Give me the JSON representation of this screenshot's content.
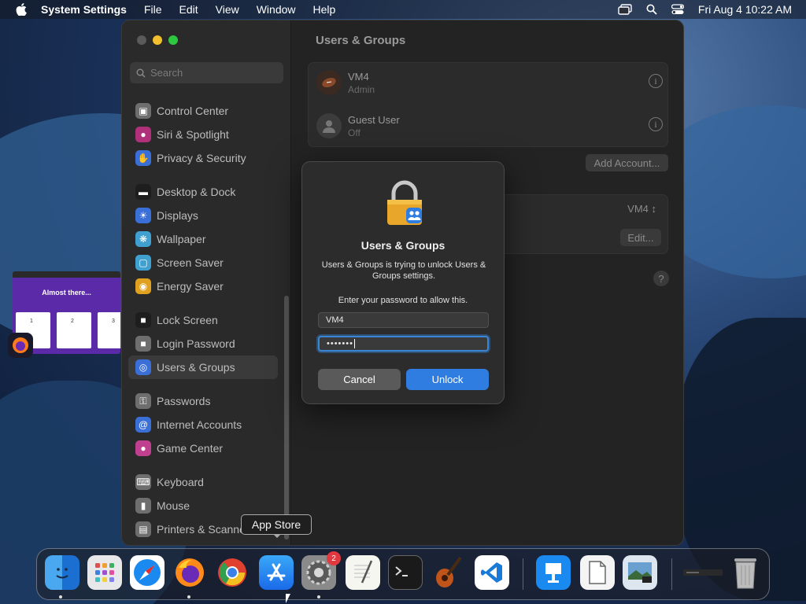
{
  "menubar": {
    "app_name": "System Settings",
    "menus": [
      "File",
      "Edit",
      "View",
      "Window",
      "Help"
    ],
    "clock": "Fri Aug 4  10:22 AM"
  },
  "sidebar": {
    "search_placeholder": "Search",
    "groups": [
      [
        {
          "label": "Control Center",
          "icon": "control-center-icon",
          "color": "#6e6e6e"
        },
        {
          "label": "Siri & Spotlight",
          "icon": "siri-icon",
          "color": "#b0307a"
        },
        {
          "label": "Privacy & Security",
          "icon": "hand-icon",
          "color": "#3a6fd8"
        }
      ],
      [
        {
          "label": "Desktop & Dock",
          "icon": "dock-icon",
          "color": "#1e1e1e"
        },
        {
          "label": "Displays",
          "icon": "sun-icon",
          "color": "#3a6fd8"
        },
        {
          "label": "Wallpaper",
          "icon": "wallpaper-icon",
          "color": "#40a0d0"
        },
        {
          "label": "Screen Saver",
          "icon": "screensaver-icon",
          "color": "#40a0d0"
        },
        {
          "label": "Energy Saver",
          "icon": "bulb-icon",
          "color": "#e0a020"
        }
      ],
      [
        {
          "label": "Lock Screen",
          "icon": "lock-icon",
          "color": "#1e1e1e"
        },
        {
          "label": "Login Password",
          "icon": "lock-icon",
          "color": "#6e6e6e"
        },
        {
          "label": "Users & Groups",
          "icon": "users-icon",
          "color": "#3a6fd8",
          "active": true
        }
      ],
      [
        {
          "label": "Passwords",
          "icon": "key-icon",
          "color": "#6e6e6e"
        },
        {
          "label": "Internet Accounts",
          "icon": "at-icon",
          "color": "#3a6fd8"
        },
        {
          "label": "Game Center",
          "icon": "gamecenter-icon",
          "color": "#c04090"
        }
      ],
      [
        {
          "label": "Keyboard",
          "icon": "keyboard-icon",
          "color": "#6e6e6e"
        },
        {
          "label": "Mouse",
          "icon": "mouse-icon",
          "color": "#6e6e6e"
        },
        {
          "label": "Printers & Scanners",
          "icon": "printer-icon",
          "color": "#6e6e6e"
        }
      ]
    ]
  },
  "main": {
    "title": "Users & Groups",
    "users": [
      {
        "name": "VM4",
        "role": "Admin"
      },
      {
        "name": "Guest User",
        "role": "Off"
      }
    ],
    "add_account_label": "Add Account...",
    "autologin_value": "VM4 ↕",
    "edit_label": "Edit...",
    "help_label": "?"
  },
  "dialog": {
    "title": "Users & Groups",
    "message": "Users & Groups is trying to unlock Users & Groups settings.",
    "prompt": "Enter your password to allow this.",
    "username": "VM4",
    "password_mask": "•••••••",
    "cancel_label": "Cancel",
    "unlock_label": "Unlock"
  },
  "thumbnail": {
    "title": "Almost there...",
    "steps": [
      "1",
      "2",
      "3"
    ]
  },
  "tooltip": "App Store",
  "dock": {
    "settings_badge": "2",
    "items": [
      "finder",
      "launchpad",
      "safari",
      "firefox",
      "chrome",
      "app-store",
      "system-settings",
      "textedit",
      "terminal",
      "garageband",
      "vscode",
      "keynote",
      "preview",
      "photos-viewer",
      "window-thumb",
      "trash"
    ]
  }
}
